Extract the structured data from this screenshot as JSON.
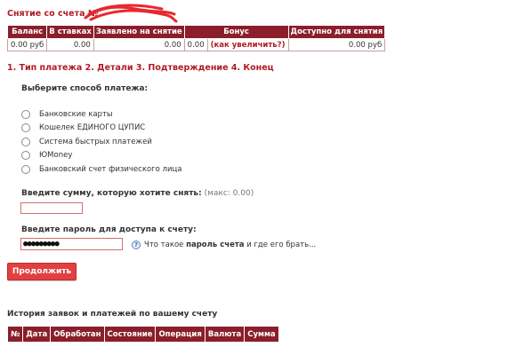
{
  "header": {
    "title": "Снятие со счета №"
  },
  "summary": {
    "columns": [
      "Баланс",
      "В ставках",
      "Заявлено на снятие",
      "Бонус",
      "Доступно для снятия"
    ],
    "balance": "0.00 руб",
    "in_bets": "0.00",
    "requested": "0.00",
    "bonus_value": "0.00",
    "bonus_link": "(как увеличить?)",
    "available": "0.00 руб"
  },
  "steps": "1. Тип платежа 2. Детали 3. Подтверждение 4. Конец",
  "payment": {
    "label": "Выберите способ платежа:",
    "methods": [
      "Банковские карты",
      "Кошелек ЕДИНОГО ЦУПИС",
      "Система быстрых платежей",
      "ЮMoney",
      "Банковский счет физического лица"
    ]
  },
  "amount": {
    "label": "Введите сумму, которую хотите снять:",
    "max": "(макс: 0.00)",
    "value": ""
  },
  "password": {
    "label": "Введите пароль для доступа к счету:",
    "value": "●●●●●●●●●",
    "help_icon": "question-icon",
    "help_prefix": "Что такое",
    "help_bold": "пароль счета",
    "help_suffix": "и где его брать..."
  },
  "continue_label": "Продолжить",
  "history": {
    "title": "История заявок и платежей по вашему счету",
    "columns": [
      "№",
      "Дата",
      "Обработан",
      "Состояние",
      "Операция",
      "Валюта",
      "Сумма"
    ]
  },
  "colors": {
    "accent": "#8a1f2b",
    "link": "#b01c23",
    "button": "#e04040"
  }
}
